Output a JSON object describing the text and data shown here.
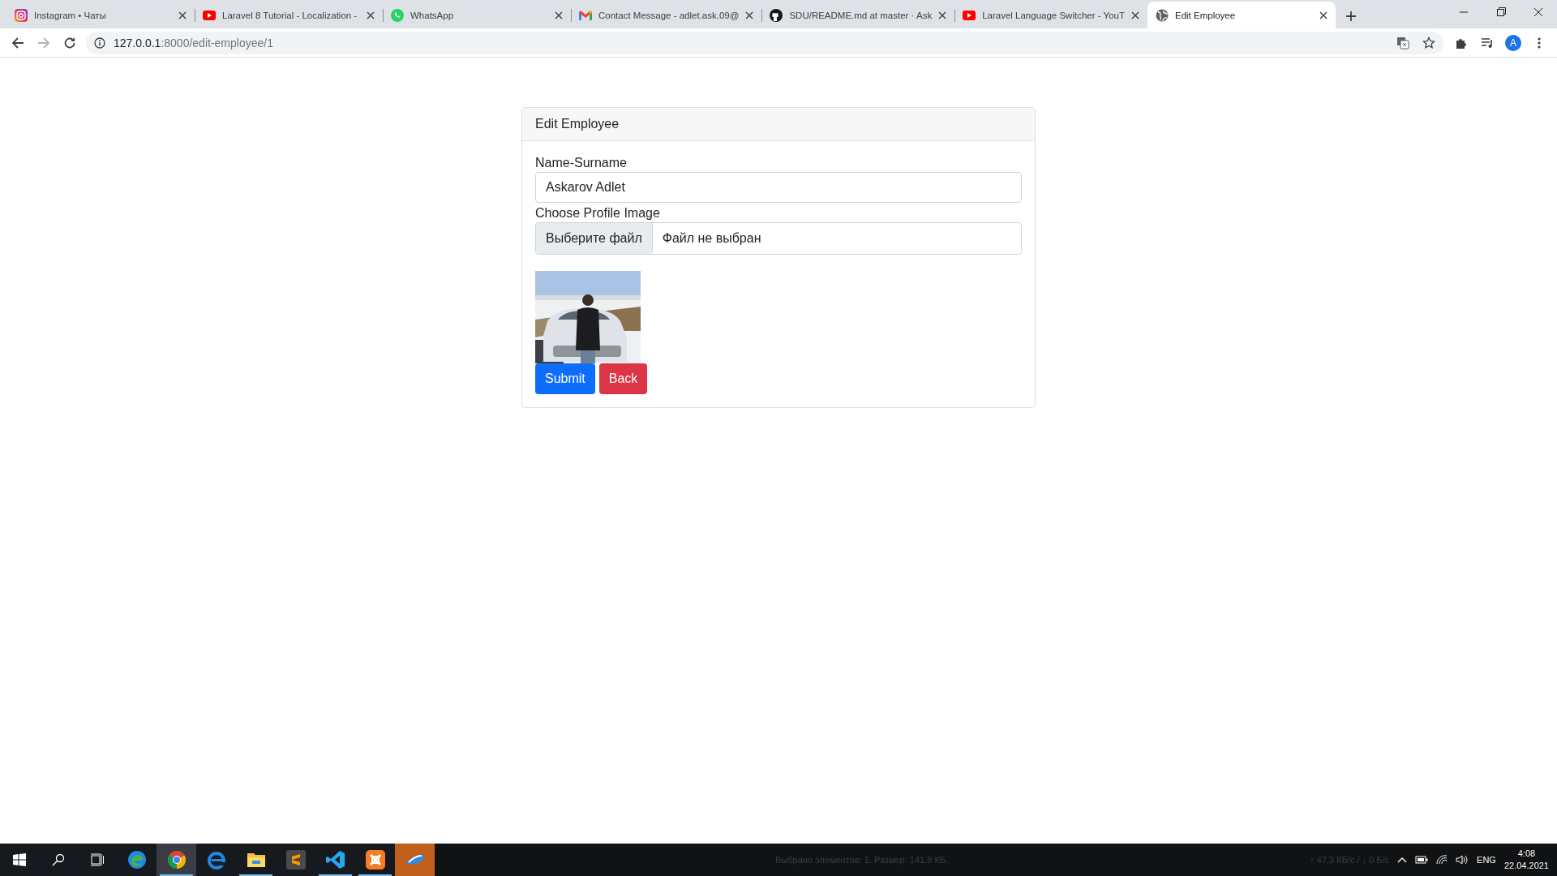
{
  "browser": {
    "tabs": [
      {
        "kind": "instagram",
        "title": "Instagram • Чаты",
        "selected": false
      },
      {
        "kind": "youtube",
        "title": "Laravel 8 Tutorial - Localization -",
        "selected": false
      },
      {
        "kind": "whatsapp",
        "title": "WhatsApp",
        "selected": false
      },
      {
        "kind": "gmail",
        "title": "Contact Message - adlet.ask.09@",
        "selected": false
      },
      {
        "kind": "github",
        "title": "SDU/README.md at master · Ask",
        "selected": false
      },
      {
        "kind": "youtube",
        "title": "Laravel Language Switcher - YouT",
        "selected": false
      },
      {
        "kind": "globe",
        "title": "Edit Employee",
        "selected": true
      }
    ],
    "address": {
      "host": "127.0.0.1",
      "path": ":8000/edit-employee/1"
    },
    "profile_initial": "A"
  },
  "card": {
    "title": "Edit Employee",
    "name_label": "Name-Surname",
    "name_value": "Askarov Adlet",
    "image_label": "Choose Profile Image",
    "file_button": "Выберите файл",
    "file_status": "Файл не выбран",
    "buttons": [
      {
        "label": "Submit",
        "kind": "primary"
      },
      {
        "label": "Back",
        "kind": "danger"
      }
    ]
  },
  "taskbar": {
    "apps": [
      {
        "kind": "edge",
        "running": false,
        "active": false
      },
      {
        "kind": "chrome",
        "running": true,
        "active": true
      },
      {
        "kind": "ie",
        "running": false,
        "active": false
      },
      {
        "kind": "explorer",
        "running": true,
        "active": false
      },
      {
        "kind": "sublime",
        "running": false,
        "active": false
      },
      {
        "kind": "vscode",
        "running": true,
        "active": false
      },
      {
        "kind": "xampp",
        "running": true,
        "active": false
      },
      {
        "kind": "transfer",
        "running": false,
        "active": false,
        "flashing": true
      }
    ],
    "status_text": "Выбрано элементов: 1. Размер: 141.8 КБ.",
    "network_speed": "↑ 47.3 КБ/с / ↓ 0 Б/с",
    "language": "ENG",
    "time": "4:08",
    "date": "22.04.2021"
  }
}
